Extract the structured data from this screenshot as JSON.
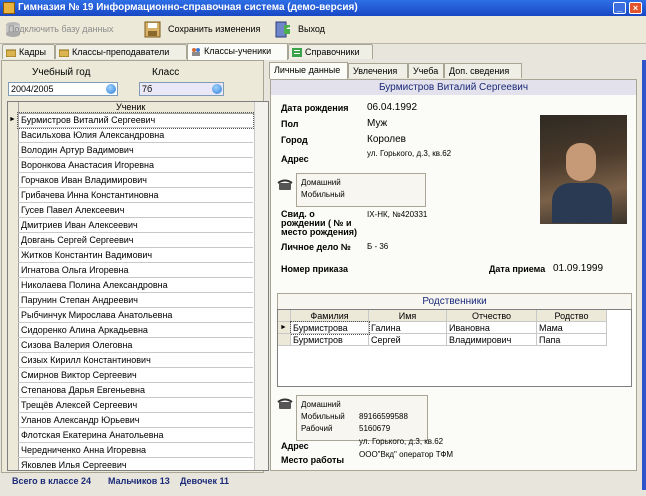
{
  "window": {
    "title": "Гимназия № 19    Информационно-справочная система (демо-версия)"
  },
  "toolbar": {
    "connect_label": "Подключить базу данных",
    "save_label": "Сохранить изменения",
    "exit_label": "Выход"
  },
  "tabs": [
    {
      "label": "Кадры",
      "icon": "folder-icon"
    },
    {
      "label": "Классы-преподаватели",
      "icon": "folder-icon"
    },
    {
      "label": "Классы-ученики",
      "icon": "people-icon"
    },
    {
      "label": "Справочники",
      "icon": "list-icon"
    }
  ],
  "filters": {
    "year_label": "Учебный год",
    "year_value": "2004/2005",
    "class_label": "Класс",
    "class_value": "7б"
  },
  "students": {
    "column_header": "Ученик",
    "rows": [
      "Бурмистров Виталий Сергеевич",
      "Васильхова Юлия Александровна",
      "Володин Артур Вадимович",
      "Воронкова Анастасия Игоревна",
      "Горчаков Иван Владимирович",
      "Грибачева Инна Константиновна",
      "Гусев Павел Алексеевич",
      "Дмитриев Иван Алексеевич",
      "Довгань Сергей Сергеевич",
      "Житков Константин Вадимович",
      "Игнатова Ольга Игоревна",
      "Николаева Полина Александровна",
      "Парунин Степан Андреевич",
      "Рыбчинчук Мирослава Анатольевна",
      "Сидоренко Алина Аркадьевна",
      "Сизова Валерия Олеговна",
      "Сизых Кирилл Константинович",
      "Смирнов Виктор Сергеевич",
      "Степанова Дарья Евгеньевна",
      "Трещёв Алексей Сергеевич",
      "Уланов Александр Юрьевич",
      "Флотская Екатерина Анатольевна",
      "Чередниченко Анна Игоревна",
      "Яковлев Илья Сергеевич"
    ]
  },
  "status": {
    "total": "Всего в классе 24",
    "boys": "Мальчиков 13",
    "girls": "Девочек 11"
  },
  "detail_tabs": [
    "Личные данные",
    "Увлечения",
    "Учеба",
    "Доп. сведения"
  ],
  "person": {
    "full_name": "Бурмистров Виталий Сергеевич",
    "birth_label": "Дата рождения",
    "birth_value": "06.04.1992",
    "sex_label": "Пол",
    "sex_value": "Муж",
    "city_label": "Город",
    "city_value": "Королев",
    "address_label": "Адрес",
    "address_value": "ул. Горького, д.3, кв.62",
    "phone_home": "Домашний",
    "phone_mobile": "Мобильный",
    "cert_label": "Свид. о рождении ( № и место рождения)",
    "cert_value": "IX-НК, №420331",
    "file_label": "Личное дело №",
    "file_value": "Б - 36",
    "order_label": "Номер приказа",
    "admission_label": "Дата приема",
    "admission_value": "01.09.1999"
  },
  "relatives": {
    "title": "Родственники",
    "columns": [
      "Фамилия",
      "Имя",
      "Отчество",
      "Родство"
    ],
    "rows": [
      [
        "Бурмистрова",
        "Галина",
        "Ивановна",
        "Мама"
      ],
      [
        "Бурмистров",
        "Сергей",
        "Владимирович",
        "Папа"
      ]
    ]
  },
  "relative_contact": {
    "home_label": "Домашний",
    "mobile_label": "Мобильный",
    "mobile_value": "89166599588",
    "work_label": "Рабочий",
    "work_value": "5160679",
    "address_label": "Адрес",
    "address_value": "ул. Горького, д.3, кв.62",
    "job_label": "Место работы",
    "job_value": "ООО\"Вкд\" оператор ТФМ"
  }
}
